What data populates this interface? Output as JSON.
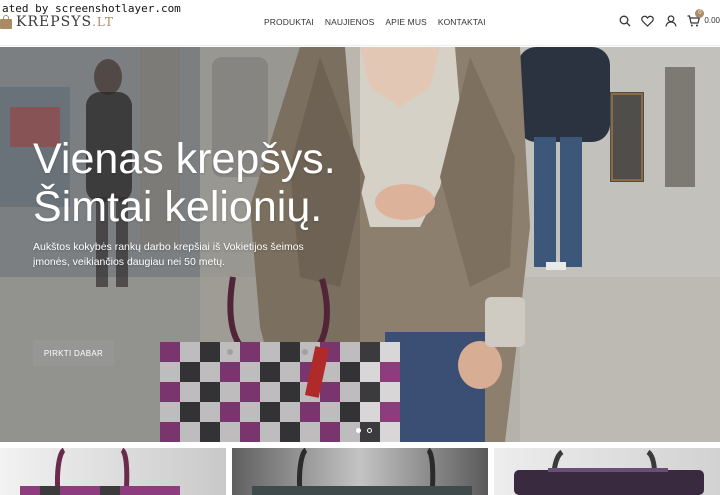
{
  "watermark": "ated by screenshotlayer.com",
  "logo": {
    "name": "KREPSYS",
    "tld": ".LT"
  },
  "nav": {
    "items": [
      {
        "label": "PRODUKTAI"
      },
      {
        "label": "NAUJIENOS"
      },
      {
        "label": "APIE MUS"
      },
      {
        "label": "KONTAKTAI"
      }
    ]
  },
  "tools": {
    "icons": [
      "search-icon",
      "heart-icon",
      "user-icon",
      "cart-icon"
    ],
    "cart_count": "0",
    "cart_total": "0.00"
  },
  "hero": {
    "title_line1": "Vienas krepšys.",
    "title_line2": "Šimtai kelionių.",
    "subtitle": "Aukštos kokybės rankų darbo krepšiai iš Vokietijos šeimos įmonės, veikiančios daugiau nei 50 metų.",
    "button_label": "PIRKTI DABAR",
    "slides": 2,
    "active_slide": 1
  },
  "colors": {
    "accent": "#a98b66",
    "text": "#333333",
    "white": "#ffffff"
  }
}
